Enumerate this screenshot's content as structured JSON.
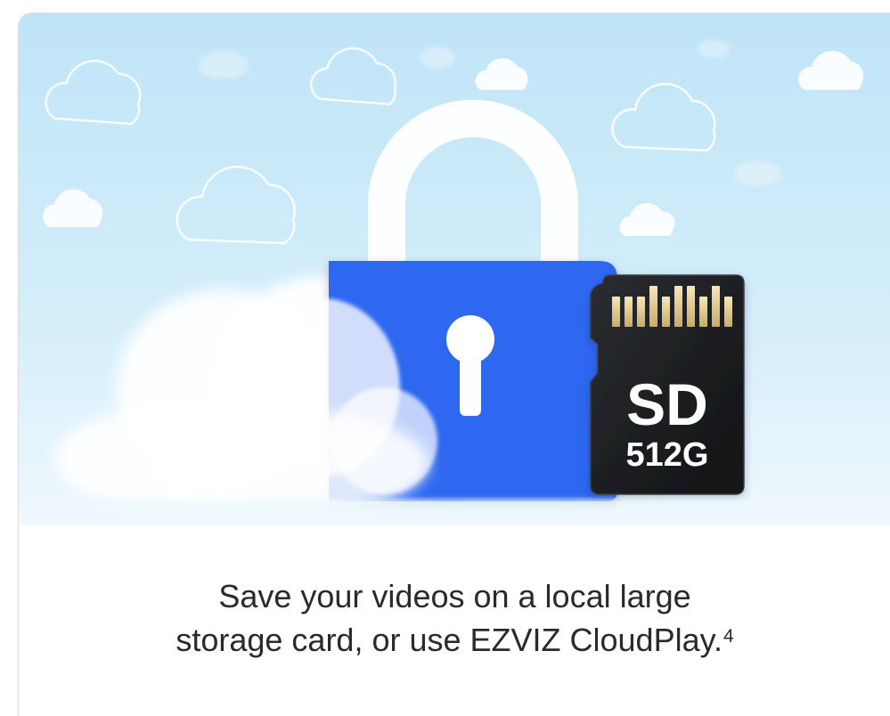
{
  "hero": {
    "lock_color": "#2f67f0",
    "sky_top_color": "#bde3f7",
    "sky_bottom_color": "#eef8fd",
    "sd_card": {
      "label_top": "SD",
      "label_bottom": "512G"
    }
  },
  "caption": {
    "line1": "Save your videos on a local large",
    "line2": "storage card, or use EZVIZ CloudPlay.",
    "footnote": "4"
  }
}
